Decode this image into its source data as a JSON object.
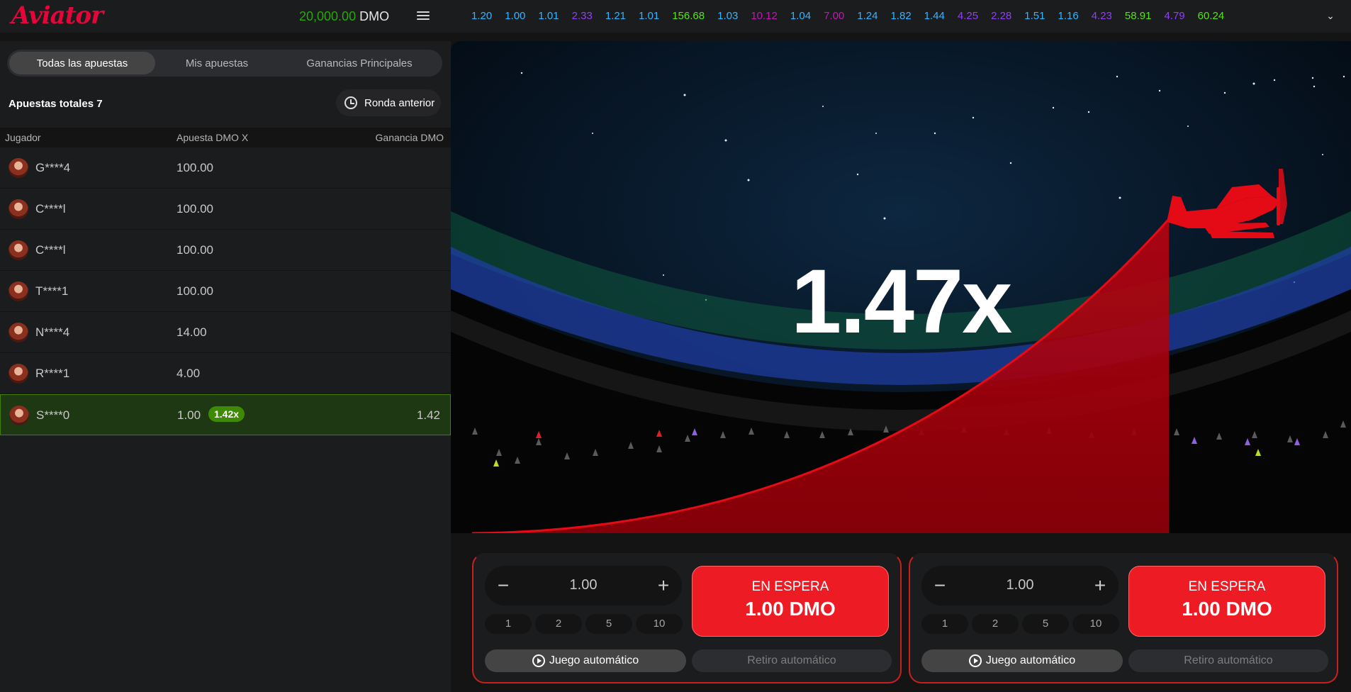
{
  "header": {
    "logo": "Aviator",
    "balance_amount": "20,000.00",
    "balance_currency": "DMO",
    "history": [
      {
        "value": "1.20",
        "color": "#34b4ff"
      },
      {
        "value": "1.00",
        "color": "#34b4ff"
      },
      {
        "value": "1.01",
        "color": "#34b4ff"
      },
      {
        "value": "2.33",
        "color": "#913ef8"
      },
      {
        "value": "1.21",
        "color": "#34b4ff"
      },
      {
        "value": "1.01",
        "color": "#34b4ff"
      },
      {
        "value": "156.68",
        "color": "#5be114"
      },
      {
        "value": "1.03",
        "color": "#34b4ff"
      },
      {
        "value": "10.12",
        "color": "#c017b4"
      },
      {
        "value": "1.04",
        "color": "#34b4ff"
      },
      {
        "value": "7.00",
        "color": "#c017b4"
      },
      {
        "value": "1.24",
        "color": "#34b4ff"
      },
      {
        "value": "1.82",
        "color": "#34b4ff"
      },
      {
        "value": "1.44",
        "color": "#34b4ff"
      },
      {
        "value": "4.25",
        "color": "#913ef8"
      },
      {
        "value": "2.28",
        "color": "#913ef8"
      },
      {
        "value": "1.51",
        "color": "#34b4ff"
      },
      {
        "value": "1.16",
        "color": "#34b4ff"
      },
      {
        "value": "4.23",
        "color": "#913ef8"
      },
      {
        "value": "58.91",
        "color": "#5be114"
      },
      {
        "value": "4.79",
        "color": "#913ef8"
      },
      {
        "value": "60.24",
        "color": "#5be114"
      }
    ]
  },
  "left": {
    "tabs": [
      "Todas las apuestas",
      "Mis apuestas",
      "Ganancias Principales"
    ],
    "total_label": "Apuestas totales 7",
    "prev_round_label": "Ronda anterior",
    "columns": {
      "player": "Jugador",
      "bet": "Apuesta DMO X",
      "win": "Ganancia DMO"
    },
    "rows": [
      {
        "player": "G****4",
        "bet": "100.00"
      },
      {
        "player": "C****l",
        "bet": "100.00"
      },
      {
        "player": "C****l",
        "bet": "100.00"
      },
      {
        "player": "T****1",
        "bet": "100.00"
      },
      {
        "player": "N****4",
        "bet": "14.00"
      },
      {
        "player": "R****1",
        "bet": "4.00"
      },
      {
        "player": "S****0",
        "bet": "1.00",
        "coef": "1.42x",
        "win": "1.42"
      }
    ]
  },
  "game": {
    "multiplier": "1.47x"
  },
  "bets": [
    {
      "amount": "1.00",
      "quick": [
        "1",
        "2",
        "5",
        "10"
      ],
      "status": "EN ESPERA",
      "btn_amount": "1.00 DMO",
      "auto_game": "Juego automático",
      "auto_cashout": "Retiro automático"
    },
    {
      "amount": "1.00",
      "quick": [
        "1",
        "2",
        "5",
        "10"
      ],
      "status": "EN ESPERA",
      "btn_amount": "1.00 DMO",
      "auto_game": "Juego automático",
      "auto_cashout": "Retiro automático"
    }
  ]
}
